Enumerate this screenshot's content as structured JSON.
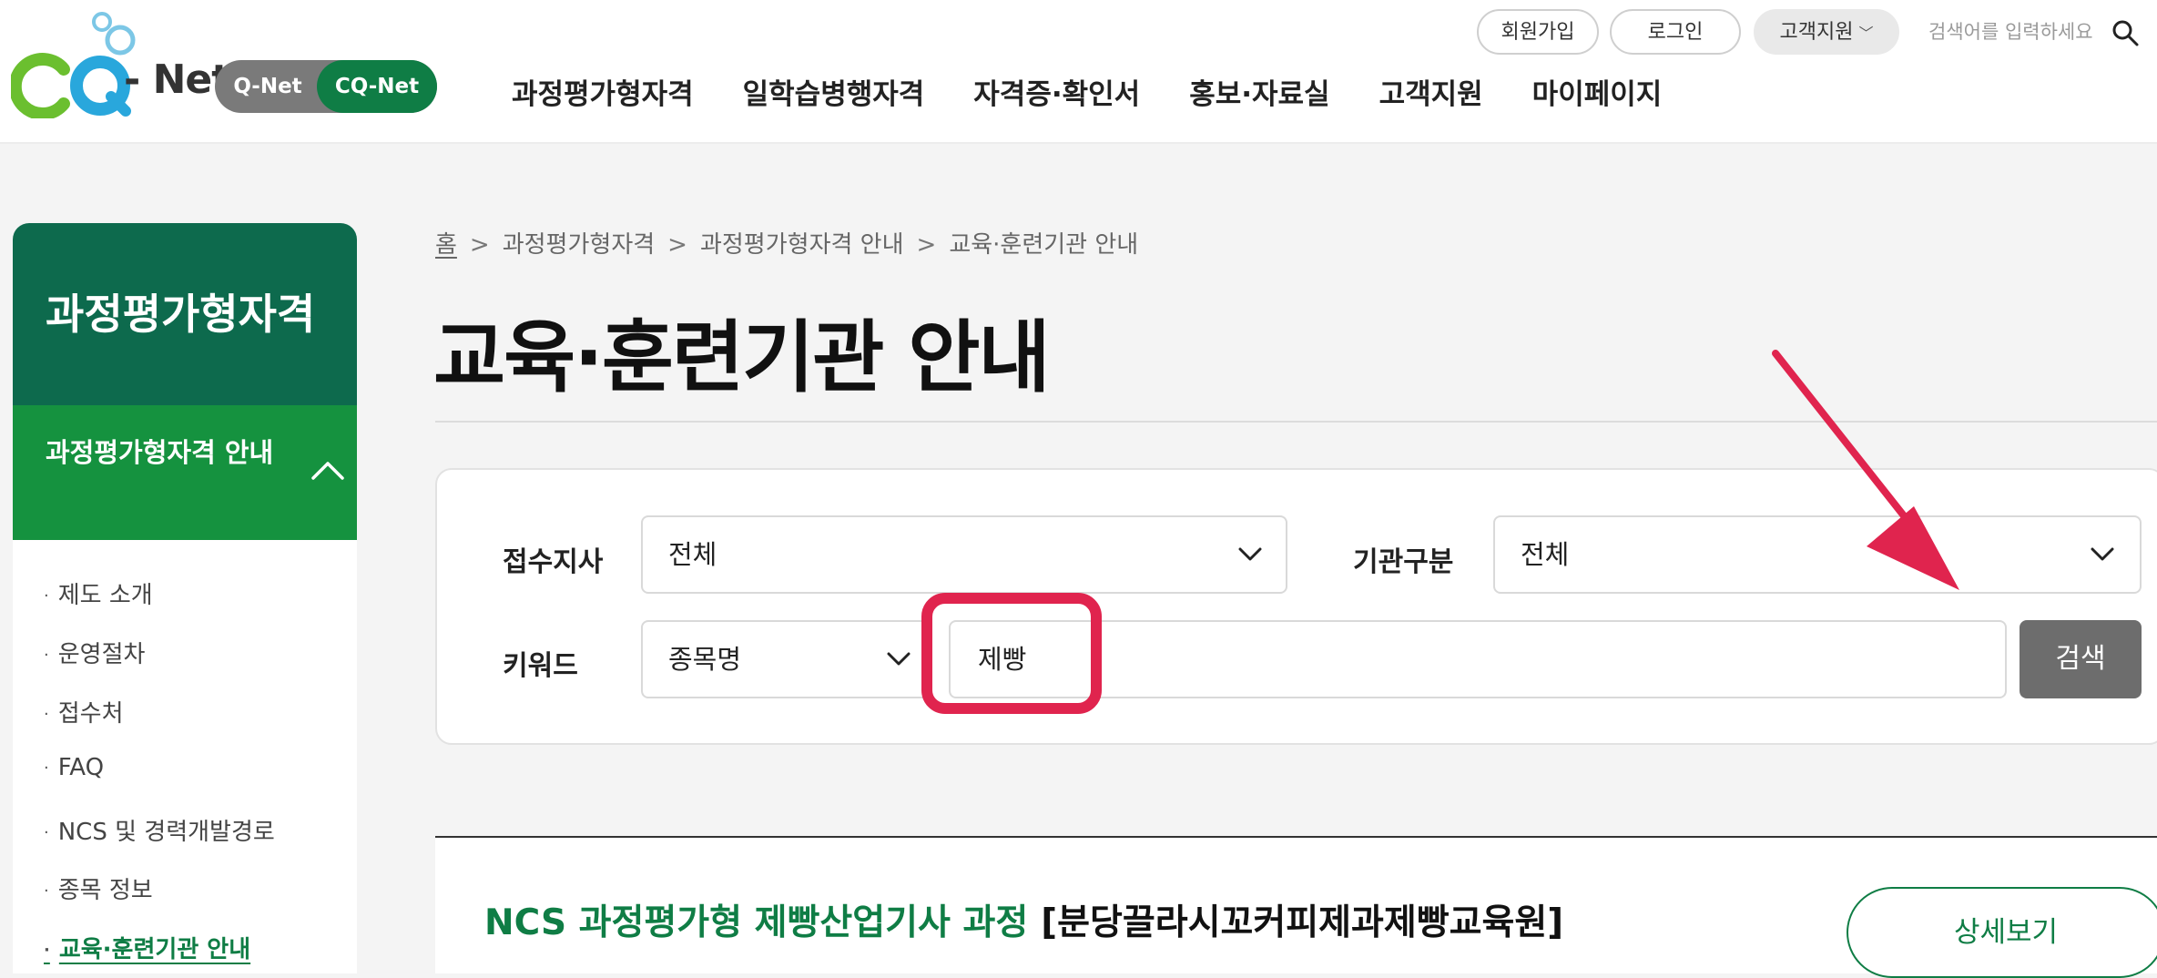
{
  "header": {
    "logo_text": "- Net",
    "net_toggle": {
      "q_label": "Q-Net",
      "cq_label": "CQ-Net",
      "selected": "CQ-Net"
    },
    "gnb": [
      "과정평가형자격",
      "일학습병행자격",
      "자격증·확인서",
      "홍보·자료실",
      "고객지원",
      "마이페이지"
    ],
    "util": {
      "join": "회원가입",
      "login": "로그인",
      "support": "고객지원"
    },
    "search_placeholder": "검색어를 입력하세요",
    "search_icon": "search-icon"
  },
  "sidebar": {
    "title": "과정평가형자격",
    "section": {
      "label": "과정평가형자격 안내",
      "expanded": true,
      "icon": "chevron-up-icon"
    },
    "items": [
      {
        "label": "제도 소개"
      },
      {
        "label": "운영절차"
      },
      {
        "label": "접수처"
      },
      {
        "label": "FAQ"
      },
      {
        "label": "NCS 및 경력개발경로"
      },
      {
        "label": "종목 정보"
      },
      {
        "label": "교육·훈련기관 안내",
        "active": true
      }
    ]
  },
  "breadcrumb": [
    "홈",
    "과정평가형자격",
    "과정평가형자격 안내",
    "교육·훈련기관 안내"
  ],
  "page_title": "교육·훈련기관 안내",
  "search_form": {
    "branch_label": "접수지사",
    "branch_value": "전체",
    "org_type_label": "기관구분",
    "org_type_value": "전체",
    "keyword_label": "키워드",
    "keyword_type_value": "종목명",
    "keyword_value": "제빵",
    "search_button": "검색"
  },
  "results": [
    {
      "course": "NCS 과정평가형 제빵산업기사 과정",
      "org": "[분당끌라시꼬커피제과제빵교육원]",
      "detail_button": "상세보기"
    }
  ],
  "colors": {
    "brand_green": "#0f7d45",
    "sidebar_dark": "#0d6a4d",
    "sidebar_active": "#15923f",
    "annotation_red": "#e0244e",
    "search_button_gray": "#6d6d6d"
  }
}
